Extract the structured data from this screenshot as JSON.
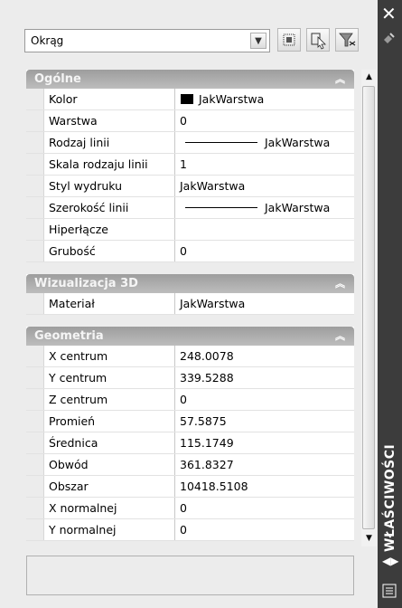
{
  "object_selector": {
    "value": "Okrąg"
  },
  "toolbar": {
    "buttons": [
      "toggle-pickadd-icon",
      "select-objects-icon",
      "quick-select-icon"
    ]
  },
  "sections": [
    {
      "title": "Ogólne",
      "rows": [
        {
          "label": "Kolor",
          "value": "JakWarstwa",
          "swatch": "#000000"
        },
        {
          "label": "Warstwa",
          "value": "0"
        },
        {
          "label": "Rodzaj linii",
          "value": "JakWarstwa",
          "line": true
        },
        {
          "label": "Skala rodzaju linii",
          "value": "1"
        },
        {
          "label": "Styl wydruku",
          "value": "JakWarstwa"
        },
        {
          "label": "Szerokość linii",
          "value": "JakWarstwa",
          "line": true
        },
        {
          "label": "Hiperłącze",
          "value": ""
        },
        {
          "label": "Grubość",
          "value": "0"
        }
      ]
    },
    {
      "title": "Wizualizacja 3D",
      "rows": [
        {
          "label": "Materiał",
          "value": "JakWarstwa"
        }
      ]
    },
    {
      "title": "Geometria",
      "rows": [
        {
          "label": "X centrum",
          "value": "248.0078"
        },
        {
          "label": "Y centrum",
          "value": "339.5288"
        },
        {
          "label": "Z centrum",
          "value": "0"
        },
        {
          "label": "Promień",
          "value": "57.5875"
        },
        {
          "label": "Średnica",
          "value": "115.1749"
        },
        {
          "label": "Obwód",
          "value": "361.8327"
        },
        {
          "label": "Obszar",
          "value": "10418.5108"
        },
        {
          "label": "X normalnej",
          "value": "0"
        },
        {
          "label": "Y normalnej",
          "value": "0"
        }
      ]
    }
  ],
  "palette": {
    "title": "WŁAŚCIWOŚCI"
  }
}
